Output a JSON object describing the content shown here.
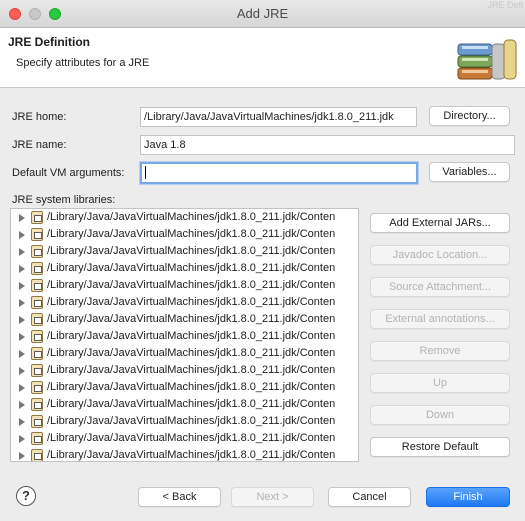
{
  "window": {
    "title": "Add JRE",
    "background_hint": "JRE Defi"
  },
  "header": {
    "title": "JRE Definition",
    "subtitle": "Specify attributes for a JRE",
    "icon": "library-books-icon"
  },
  "form": {
    "jre_home": {
      "label": "JRE home:",
      "value": "/Library/Java/JavaVirtualMachines/jdk1.8.0_211.jdk"
    },
    "jre_name": {
      "label": "JRE name:",
      "value": "Java 1.8"
    },
    "vm_args": {
      "label": "Default VM arguments:",
      "value": ""
    },
    "directory_button": "Directory...",
    "variables_button": "Variables...",
    "libraries_label": "JRE system libraries:"
  },
  "libraries": [
    "/Library/Java/JavaVirtualMachines/jdk1.8.0_211.jdk/Conten",
    "/Library/Java/JavaVirtualMachines/jdk1.8.0_211.jdk/Conten",
    "/Library/Java/JavaVirtualMachines/jdk1.8.0_211.jdk/Conten",
    "/Library/Java/JavaVirtualMachines/jdk1.8.0_211.jdk/Conten",
    "/Library/Java/JavaVirtualMachines/jdk1.8.0_211.jdk/Conten",
    "/Library/Java/JavaVirtualMachines/jdk1.8.0_211.jdk/Conten",
    "/Library/Java/JavaVirtualMachines/jdk1.8.0_211.jdk/Conten",
    "/Library/Java/JavaVirtualMachines/jdk1.8.0_211.jdk/Conten",
    "/Library/Java/JavaVirtualMachines/jdk1.8.0_211.jdk/Conten",
    "/Library/Java/JavaVirtualMachines/jdk1.8.0_211.jdk/Conten",
    "/Library/Java/JavaVirtualMachines/jdk1.8.0_211.jdk/Conten",
    "/Library/Java/JavaVirtualMachines/jdk1.8.0_211.jdk/Conten",
    "/Library/Java/JavaVirtualMachines/jdk1.8.0_211.jdk/Conten",
    "/Library/Java/JavaVirtualMachines/jdk1.8.0_211.jdk/Conten",
    "/Library/Java/JavaVirtualMachines/jdk1.8.0_211.jdk/Conten"
  ],
  "side_buttons": {
    "add_external_jars": "Add External JARs...",
    "javadoc_location": "Javadoc Location...",
    "source_attachment": "Source Attachment...",
    "external_annotations": "External annotations...",
    "remove": "Remove",
    "up": "Up",
    "down": "Down",
    "restore_default": "Restore Default"
  },
  "footer": {
    "help": "?",
    "back": "< Back",
    "next": "Next >",
    "cancel": "Cancel",
    "finish": "Finish"
  },
  "colors": {
    "accent": "#1f78f3",
    "close": "#fe5f57",
    "maximize": "#28c840"
  }
}
